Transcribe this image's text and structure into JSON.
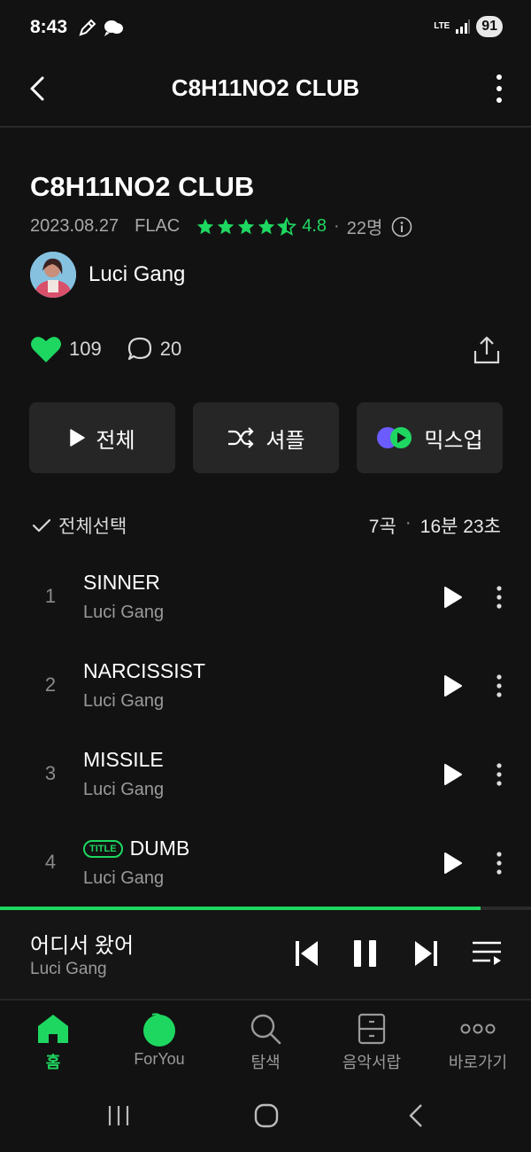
{
  "status_bar": {
    "time": "8:43",
    "network": "LTE",
    "battery": "91"
  },
  "header": {
    "title": "C8H11NO2 CLUB"
  },
  "album": {
    "title": "C8H11NO2 CLUB",
    "release_date": "2023.08.27",
    "format": "FLAC",
    "rating": "4.8",
    "rating_value": 4.8,
    "rating_count": "22명",
    "artist": "Luci Gang"
  },
  "social": {
    "likes": "109",
    "comments": "20"
  },
  "actions": {
    "play_all": "전체",
    "shuffle": "셔플",
    "mixup": "믹스업"
  },
  "list_header": {
    "select_all": "전체선택",
    "track_count": "7곡",
    "total_duration": "16분 23초"
  },
  "tracks": [
    {
      "num": "1",
      "title": "SINNER",
      "artist": "Luci Gang",
      "badge": ""
    },
    {
      "num": "2",
      "title": "NARCISSIST",
      "artist": "Luci Gang",
      "badge": ""
    },
    {
      "num": "3",
      "title": "MISSILE",
      "artist": "Luci Gang",
      "badge": ""
    },
    {
      "num": "4",
      "title": "DUMB",
      "artist": "Luci Gang",
      "badge": "TITLE"
    }
  ],
  "player": {
    "song": "어디서 왔어",
    "artist": "Luci Gang",
    "progress": 0.905
  },
  "bottom_nav": {
    "home": "홈",
    "foryou": "ForYou",
    "search": "탐색",
    "library": "음악서랍",
    "shortcuts": "바로가기"
  },
  "colors": {
    "accent": "#1ed760",
    "background": "#121212",
    "button": "#262626"
  }
}
